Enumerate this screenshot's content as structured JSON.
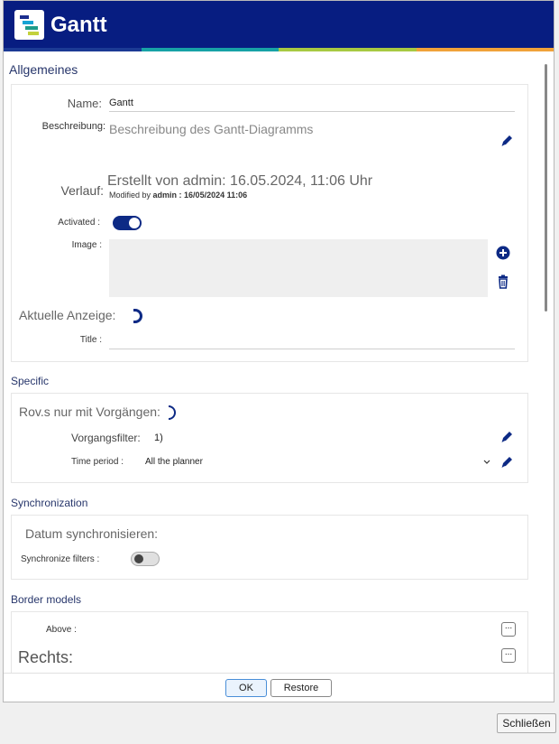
{
  "app": {
    "title": "Gantt"
  },
  "brand_stripe_colors": [
    "#1b3a94",
    "#17a2a6",
    "#a7c942",
    "#f0a23a"
  ],
  "sections": {
    "allgemeines": {
      "title": "Allgemeines",
      "name_label": "Name:",
      "name_value": "Gantt",
      "description_label": "Beschreibung:",
      "description_placeholder": "Beschreibung des Gantt-Diagramms",
      "history_label": "Verlauf:",
      "history_created": "Erstellt von admin: 16.05.2024, 11:06 Uhr",
      "history_modified_prefix": "Modified by",
      "history_modified_value": "admin : 16/05/2024 11:06",
      "activated_label": "Activated :",
      "activated": true,
      "image_label": "Image :",
      "current_display_label": "Aktuelle Anzeige:",
      "title_label": "Title :",
      "title_value": ""
    },
    "specific": {
      "title": "Specific",
      "resources_label": "Rov.s nur mit Vorgängen:",
      "filter_label": "Vorgangsfilter:",
      "filter_value": "1)",
      "time_period_label": "Time period :",
      "time_period_value": "All the planner"
    },
    "synchronization": {
      "title": "Synchronization",
      "sync_dates_label": "Datum synchronisieren:",
      "sync_filters_label": "Synchronize filters :",
      "sync_filters": false
    },
    "border_models": {
      "title": "Border models",
      "above_label": "Above :",
      "right_label": "Rechts:",
      "dots": "..."
    }
  },
  "footer": {
    "ok_label": "OK",
    "restore_label": "Restore"
  },
  "close_label": "Schließen",
  "icons": [
    "pencil-icon",
    "plus-circle-icon",
    "trash-icon",
    "chevron-down-icon"
  ],
  "colors": {
    "title_bar": "#071d81",
    "accent": "#0d2a85"
  }
}
